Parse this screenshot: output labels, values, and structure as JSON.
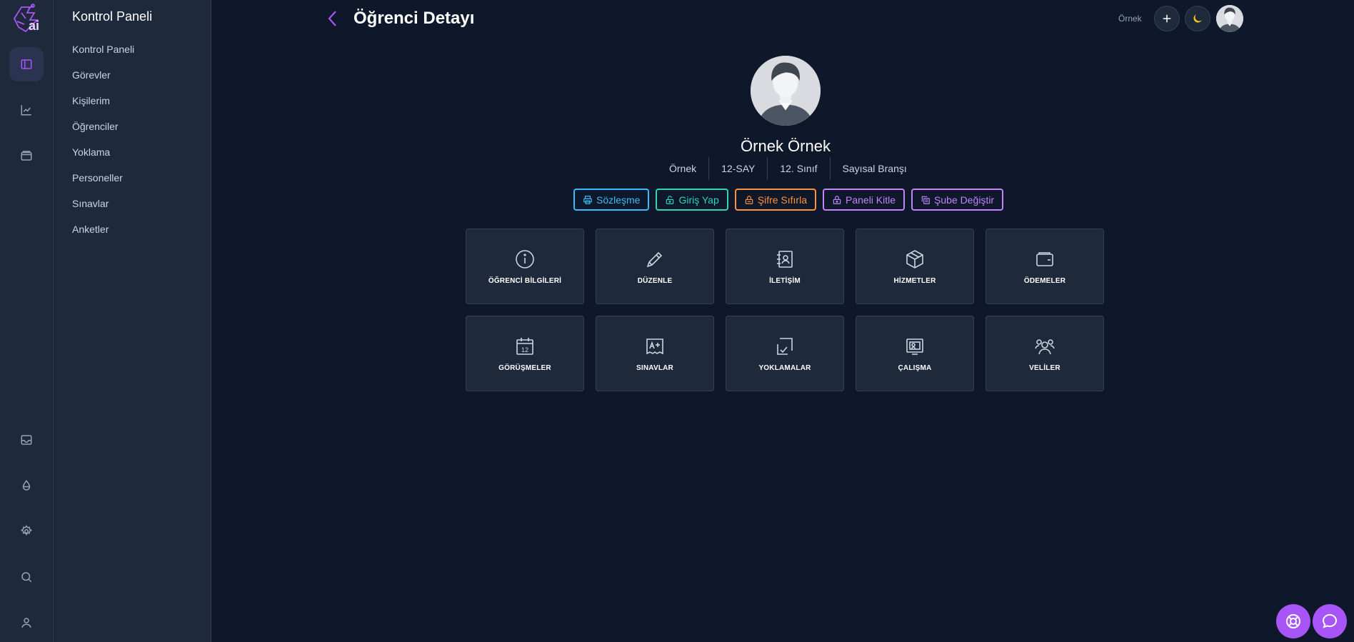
{
  "app": {
    "logo_icon": "brain-circuit-logo-icon",
    "logo_text": "ai"
  },
  "rail": {
    "top_items": [
      {
        "icon": "sidebar-panel-icon",
        "active": true
      },
      {
        "icon": "chart-line-icon",
        "active": false
      },
      {
        "icon": "wallet-icon",
        "active": false
      }
    ],
    "bottom_items": [
      {
        "icon": "inbox-icon"
      },
      {
        "icon": "droplet-icon"
      },
      {
        "icon": "gear-icon"
      },
      {
        "icon": "search-icon"
      },
      {
        "icon": "user-icon"
      }
    ]
  },
  "sidebar": {
    "title": "Kontrol Paneli",
    "items": [
      {
        "label": "Kontrol Paneli"
      },
      {
        "label": "Görevler"
      },
      {
        "label": "Kişilerim"
      },
      {
        "label": "Öğrenciler"
      },
      {
        "label": "Yoklama"
      },
      {
        "label": "Personeller"
      },
      {
        "label": "Sınavlar"
      },
      {
        "label": "Anketler"
      }
    ]
  },
  "header": {
    "title": "Öğrenci Detayı",
    "user_name": "Örnek",
    "accent": "#a855f7",
    "theme_icon_color": "#facc15"
  },
  "student": {
    "name": "Örnek Örnek",
    "meta": [
      "Örnek",
      "12-SAY",
      "12. Sınıf",
      "Sayısal Branşı"
    ]
  },
  "actions": [
    {
      "label": "Sözleşme",
      "icon": "printer-icon",
      "color": "#38bdf8"
    },
    {
      "label": "Giriş Yap",
      "icon": "unlock-icon",
      "color": "#2dd4bf"
    },
    {
      "label": "Şifre Sıfırla",
      "icon": "lock-reset-icon",
      "color": "#fb923c"
    },
    {
      "label": "Paneli Kitle",
      "icon": "lock-icon",
      "color": "#c084fc"
    },
    {
      "label": "Şube Değiştir",
      "icon": "copy-icon",
      "color": "#c084fc"
    }
  ],
  "cards": [
    {
      "label": "ÖĞRENCİ BİLGİLERİ",
      "icon": "info-circle-icon"
    },
    {
      "label": "DÜZENLE",
      "icon": "pencil-icon"
    },
    {
      "label": "İLETİŞİM",
      "icon": "address-book-icon"
    },
    {
      "label": "HİZMETLER",
      "icon": "box-icon"
    },
    {
      "label": "ÖDEMELER",
      "icon": "wallet-icon"
    },
    {
      "label": "GÖRÜŞMELER",
      "icon": "calendar-icon"
    },
    {
      "label": "SINAVLAR",
      "icon": "exam-grade-icon"
    },
    {
      "label": "YOKLAMALAR",
      "icon": "check-square-icon"
    },
    {
      "label": "ÇALIŞMA",
      "icon": "study-icon"
    },
    {
      "label": "VELİLER",
      "icon": "users-icon"
    }
  ],
  "floating": [
    {
      "icon": "lifebuoy-icon"
    },
    {
      "icon": "chat-bubble-icon"
    }
  ],
  "calendar_day": "12"
}
